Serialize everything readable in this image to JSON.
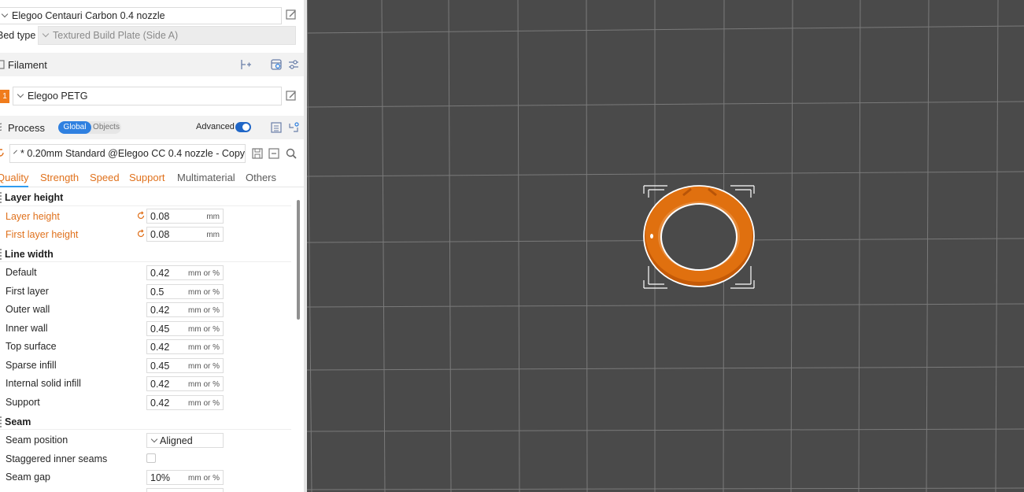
{
  "printer": {
    "name": "Elegoo Centauri Carbon 0.4 nozzle"
  },
  "bed": {
    "label": "Bed type",
    "value": "Textured Build Plate (Side A)"
  },
  "filament": {
    "title": "Filament",
    "slot_number": "1",
    "slot_color": "#f07c1c",
    "name": "Elegoo PETG"
  },
  "process": {
    "title": "Process",
    "scope_global": "Global",
    "scope_objects": "Objects",
    "advanced_label": "Advanced",
    "preset": "* 0.20mm Standard @Elegoo CC 0.4 nozzle - Copy"
  },
  "tabs": [
    {
      "label": "Quality",
      "active": true
    },
    {
      "label": "Strength"
    },
    {
      "label": "Speed"
    },
    {
      "label": "Support"
    },
    {
      "label": "Multimaterial"
    },
    {
      "label": "Others"
    }
  ],
  "groups": {
    "layer_height": {
      "title": "Layer height",
      "rows": [
        {
          "label": "Layer height",
          "value": "0.08",
          "unit": "mm"
        },
        {
          "label": "First layer height",
          "value": "0.08",
          "unit": "mm"
        }
      ]
    },
    "line_width": {
      "title": "Line width",
      "rows": [
        {
          "label": "Default",
          "value": "0.42",
          "unit": "mm or %"
        },
        {
          "label": "First layer",
          "value": "0.5",
          "unit": "mm or %"
        },
        {
          "label": "Outer wall",
          "value": "0.42",
          "unit": "mm or %"
        },
        {
          "label": "Inner wall",
          "value": "0.45",
          "unit": "mm or %"
        },
        {
          "label": "Top surface",
          "value": "0.42",
          "unit": "mm or %"
        },
        {
          "label": "Sparse infill",
          "value": "0.45",
          "unit": "mm or %"
        },
        {
          "label": "Internal solid infill",
          "value": "0.42",
          "unit": "mm or %"
        },
        {
          "label": "Support",
          "value": "0.42",
          "unit": "mm or %"
        }
      ]
    },
    "seam": {
      "title": "Seam",
      "position_label": "Seam position",
      "position_value": "Aligned",
      "staggered_label": "Staggered inner seams",
      "staggered_checked": false,
      "gap_label": "Seam gap",
      "gap_value": "10%",
      "gap_unit": "mm or %"
    }
  },
  "colors": {
    "accent_orange": "#e0711c",
    "accent_blue": "#2f80e0",
    "viewport_bg": "#4a4a4a",
    "model": "#e0700f"
  }
}
